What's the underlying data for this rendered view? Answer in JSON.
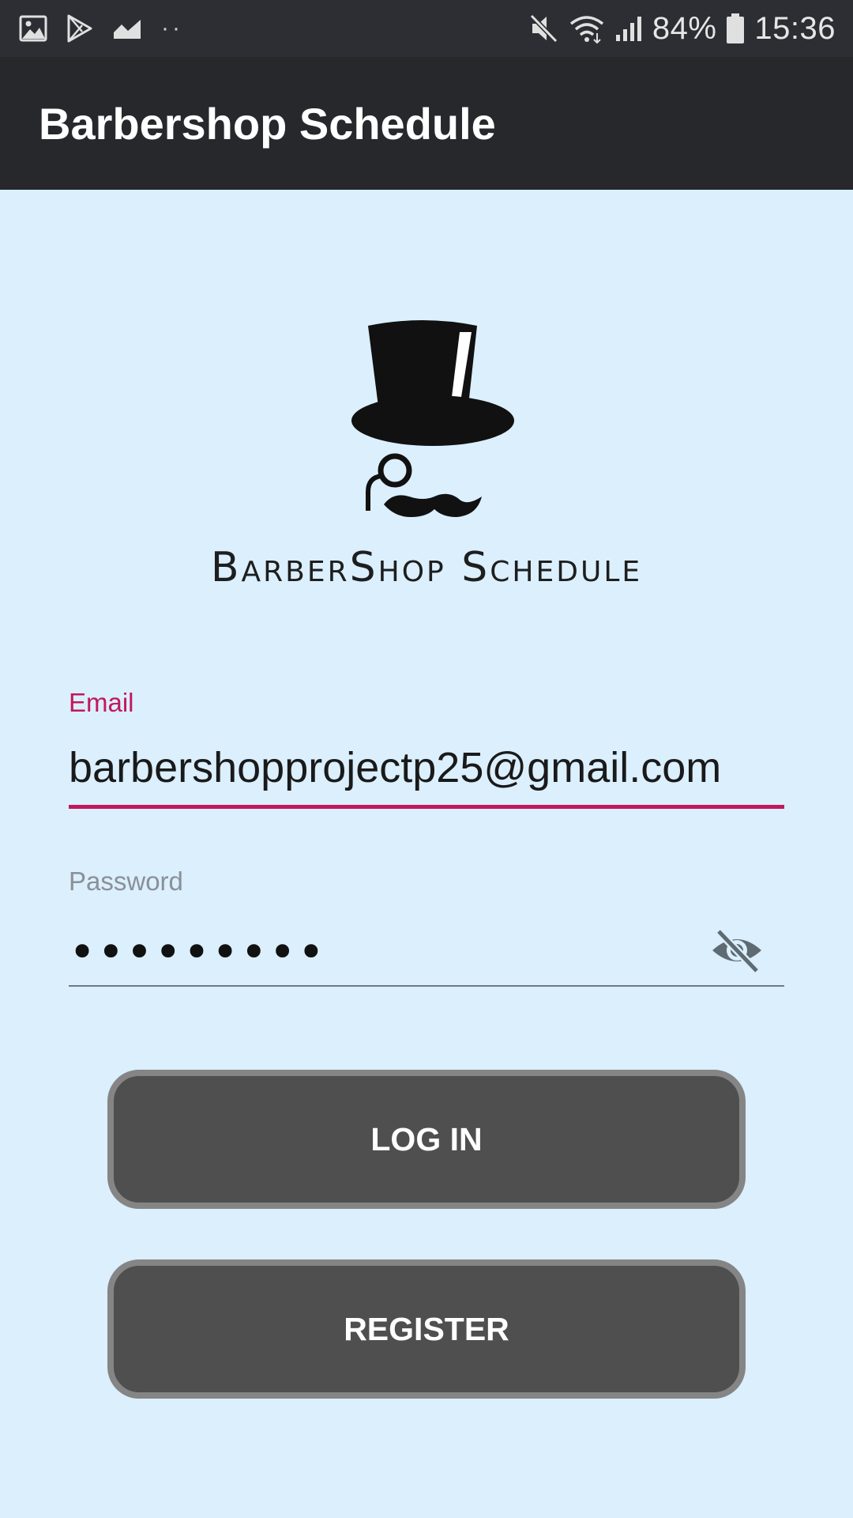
{
  "status_bar": {
    "battery": "84%",
    "time": "15:36",
    "left_icons": [
      "gallery-icon",
      "play-store-icon",
      "stocks-icon",
      "more-dots-icon"
    ],
    "right_icons": [
      "mute-icon",
      "wifi-icon",
      "signal-icon",
      "battery-icon"
    ]
  },
  "app_bar": {
    "title": "Barbershop Schedule"
  },
  "logo": {
    "text": "BarberShop Schedule",
    "icon": "top-hat-monocle-mustache-logo"
  },
  "form": {
    "email_label": "Email",
    "email_value": "barbershopprojectp25@gmail.com",
    "password_label": "Password",
    "password_masked": "•••••••••",
    "password_toggle_icon": "eye-off-icon"
  },
  "buttons": {
    "login": "LOG IN",
    "register": "REGISTER"
  },
  "colors": {
    "accent": "#c2185b",
    "background": "#dbeffd",
    "app_bar": "#26282c",
    "button_fill": "#4f4f4f",
    "button_border": "#858585"
  }
}
